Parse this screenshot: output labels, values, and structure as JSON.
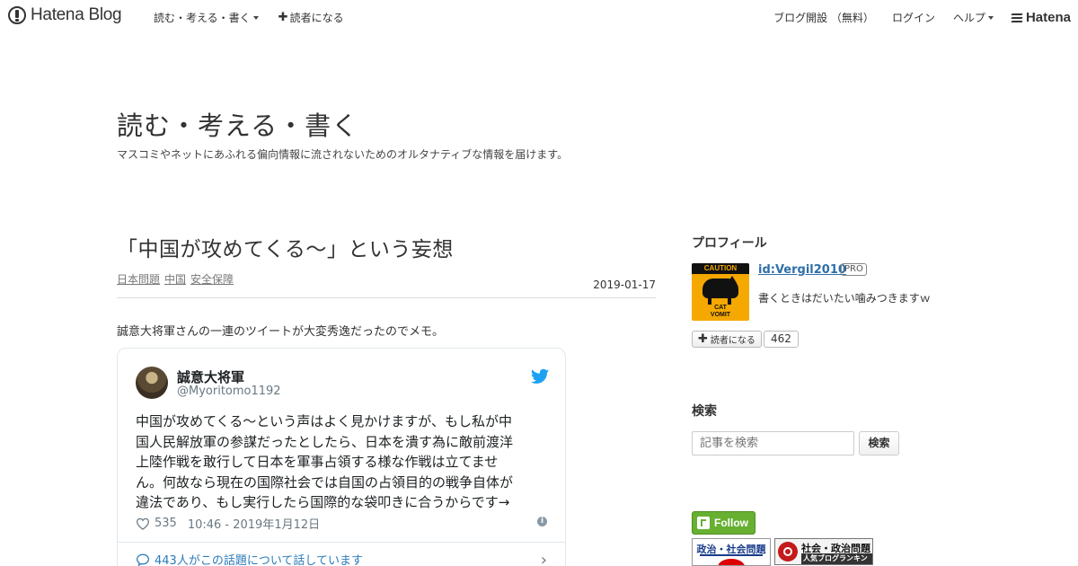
{
  "topbar": {
    "brand": "Hatena Blog",
    "blog_menu": "読む・考える・書く",
    "subscribe": "読者になる",
    "open_blog": "ブログ開設 （無料）",
    "login": "ログイン",
    "help": "ヘルプ",
    "hatena": "Hatena"
  },
  "blog": {
    "title": "読む・考える・書く",
    "description": "マスコミやネットにあふれる偏向情報に流されないためのオルタナティブな情報を届けます。"
  },
  "entry": {
    "title": "「中国が攻めてくる～」という妄想",
    "categories": [
      "日本問題",
      "中国",
      "安全保障"
    ],
    "date": "2019-01-17",
    "lead": "誠意大将軍さんの一連のツイートが大変秀逸だったのでメモ。"
  },
  "tweet": {
    "name": "誠意大将軍",
    "handle": "@Myoritomo1192",
    "lines": [
      "中国が攻めてくる～という声はよく見かけますが、もし私が中",
      "国人民解放軍の参謀だったとしたら、日本を潰す為に敵前渡洋",
      "上陸作戦を敢行して日本を軍事占領する様な作戦は立てませ",
      "ん。何故なら現在の国際社会では自国の占領目的の戦争自体が",
      "違法であり、もし実行したら国際的な袋叩きに合うからです→"
    ],
    "likes": "535",
    "timestamp": "10:46 - 2019年1月12日",
    "conversation": "443人がこの話題について話しています",
    "accent_color": "#1da1f2"
  },
  "sidebar": {
    "profile": {
      "heading": "プロフィール",
      "id": "id:Vergil2010",
      "badge": "PRO",
      "bio": "書くときはだいたい噛みつきますｗ",
      "reader_button": "読者になる",
      "reader_count": "462",
      "icon_band": "CAUTION",
      "icon_caption_1": "CAT",
      "icon_caption_2": "VOMIT"
    },
    "search": {
      "heading": "検索",
      "placeholder": "記事を検索",
      "button": "検索"
    },
    "follow_button": "Follow",
    "banner1": "政治・社会問題",
    "banner2_title": "社会・政治問題",
    "banner2_sub": "人気ブログランキング"
  }
}
